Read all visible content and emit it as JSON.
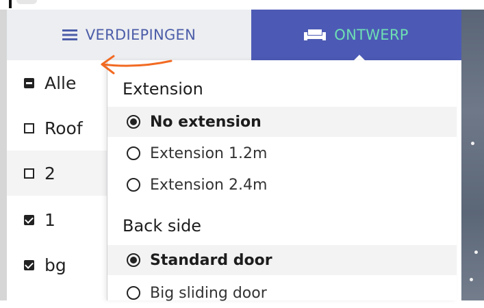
{
  "header": {
    "tabs": [
      {
        "label": "VERDIEPINGEN",
        "icon": "hamburger-icon",
        "active": false
      },
      {
        "label": "ONTWERP",
        "icon": "sofa-icon",
        "active": true
      }
    ]
  },
  "floors": [
    {
      "label": "Alle",
      "state": "indeterminate"
    },
    {
      "label": "Roof",
      "state": "unchecked"
    },
    {
      "label": "2",
      "state": "unchecked"
    },
    {
      "label": "1",
      "state": "checked"
    },
    {
      "label": "bg",
      "state": "checked"
    }
  ],
  "design_panel": {
    "groups": [
      {
        "title": "Extension",
        "options": [
          {
            "label": "No extension",
            "selected": true
          },
          {
            "label": "Extension 1.2m",
            "selected": false
          },
          {
            "label": "Extension 2.4m",
            "selected": false
          }
        ]
      },
      {
        "title": "Back side",
        "options": [
          {
            "label": "Standard door",
            "selected": true
          },
          {
            "label": "Big sliding door",
            "selected": false
          }
        ]
      }
    ]
  },
  "colors": {
    "tab_active_bg": "#4c5ab5",
    "tab_active_text": "#6ee0b3",
    "tab_inactive_text": "#4b5ca8",
    "annotation_arrow": "#f26a22"
  }
}
